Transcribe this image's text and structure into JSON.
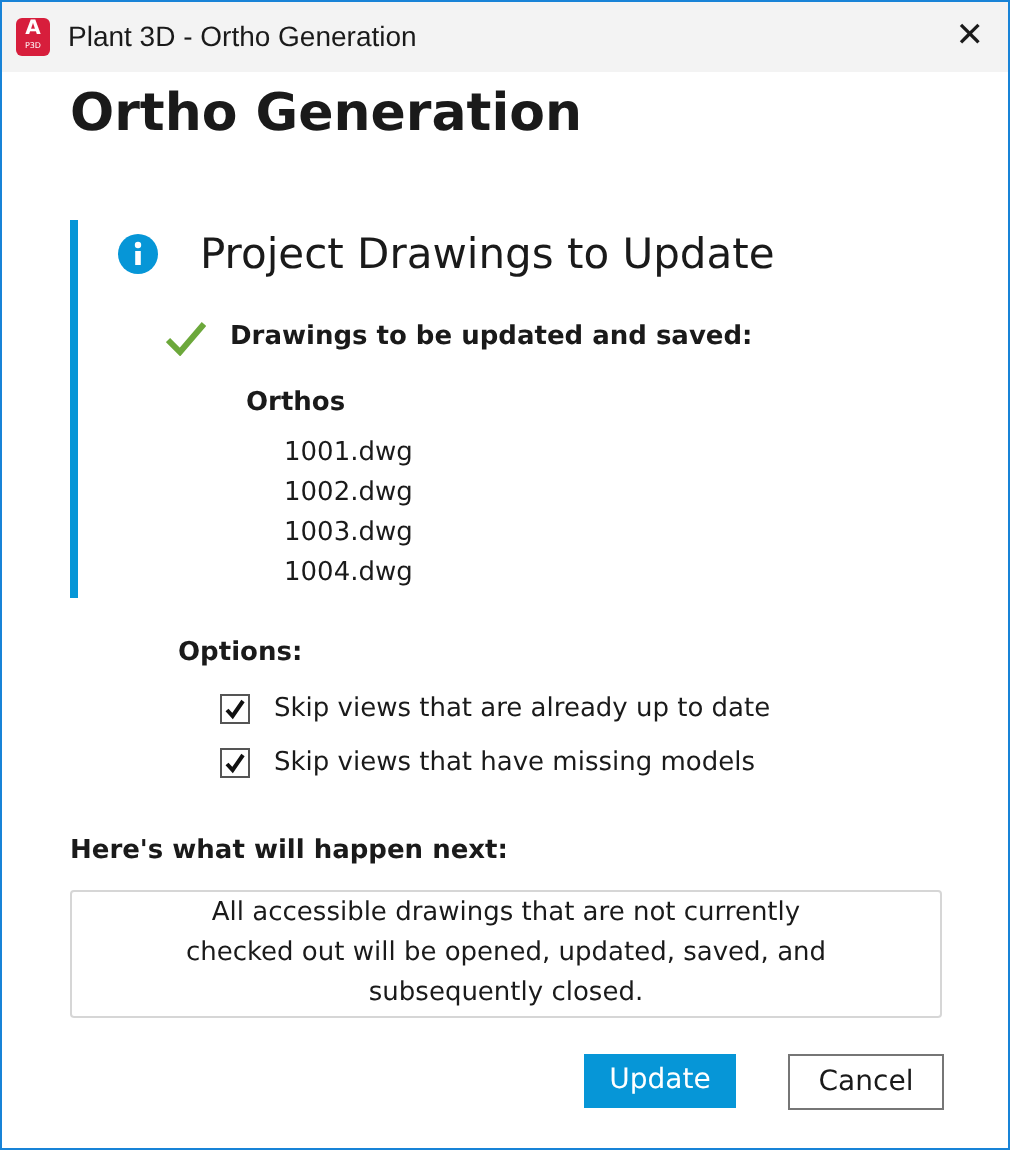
{
  "window": {
    "title": "Plant 3D - Ortho Generation",
    "app_icon": {
      "letter": "A",
      "badge": "P3D"
    },
    "close": "✕"
  },
  "heading": "Ortho Generation",
  "panel": {
    "title": "Project Drawings to Update",
    "status": "Drawings to be updated and saved:",
    "group": "Orthos",
    "files": [
      "1001.dwg",
      "1002.dwg",
      "1003.dwg",
      "1004.dwg"
    ]
  },
  "options": {
    "label": "Options:",
    "items": [
      {
        "label": "Skip views that are already up to date",
        "checked": true
      },
      {
        "label": "Skip views that have missing models",
        "checked": true
      }
    ]
  },
  "next": {
    "label": "Here's what will happen next:",
    "text": "All accessible drawings that are not currently checked out will be opened, updated, saved, and subsequently closed."
  },
  "buttons": [
    {
      "label": "Update",
      "kind": "primary"
    },
    {
      "label": "Cancel",
      "kind": "secondary"
    }
  ]
}
